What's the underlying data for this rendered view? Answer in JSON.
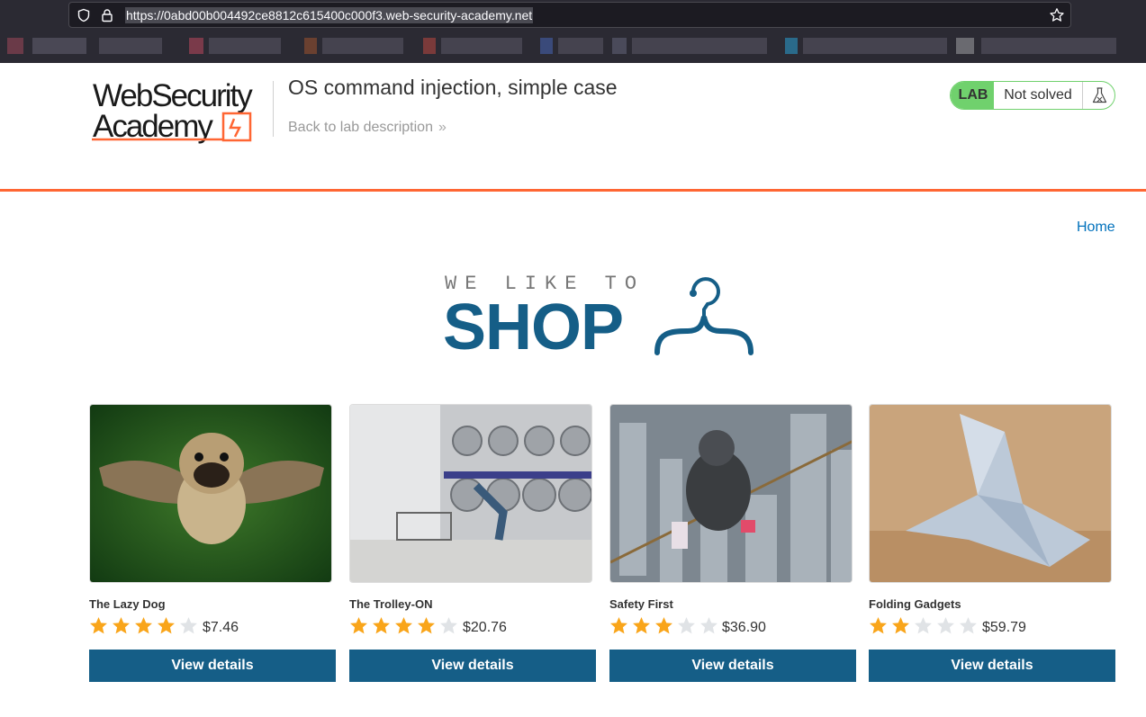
{
  "browser": {
    "url": "https://0abd00b004492ce8812c615400c000f3.web-security-academy.net"
  },
  "lab": {
    "logo_line1": "WebSecurity",
    "logo_line2": "Academy",
    "title": "OS command injection, simple case",
    "back_link": "Back to lab description",
    "back_chevron": "»",
    "badge_label": "LAB",
    "status": "Not solved"
  },
  "nav": {
    "home": "Home"
  },
  "banner": {
    "tagline": "WE LIKE TO",
    "headline": "SHOP"
  },
  "colors": {
    "accent_orange": "#ff6633",
    "primary_blue": "#155e87",
    "status_green": "#70d16d",
    "star_gold": "#f9a51a",
    "star_empty": "#e0e3e6",
    "link_blue": "#0071bc"
  },
  "products": [
    {
      "name": "The Lazy Dog",
      "rating": 4,
      "max_rating": 5,
      "price": "$7.46",
      "button": "View details"
    },
    {
      "name": "The Trolley-ON",
      "rating": 4,
      "max_rating": 5,
      "price": "$20.76",
      "button": "View details"
    },
    {
      "name": "Safety First",
      "rating": 3,
      "max_rating": 5,
      "price": "$36.90",
      "button": "View details"
    },
    {
      "name": "Folding Gadgets",
      "rating": 2,
      "max_rating": 5,
      "price": "$59.79",
      "button": "View details"
    }
  ]
}
